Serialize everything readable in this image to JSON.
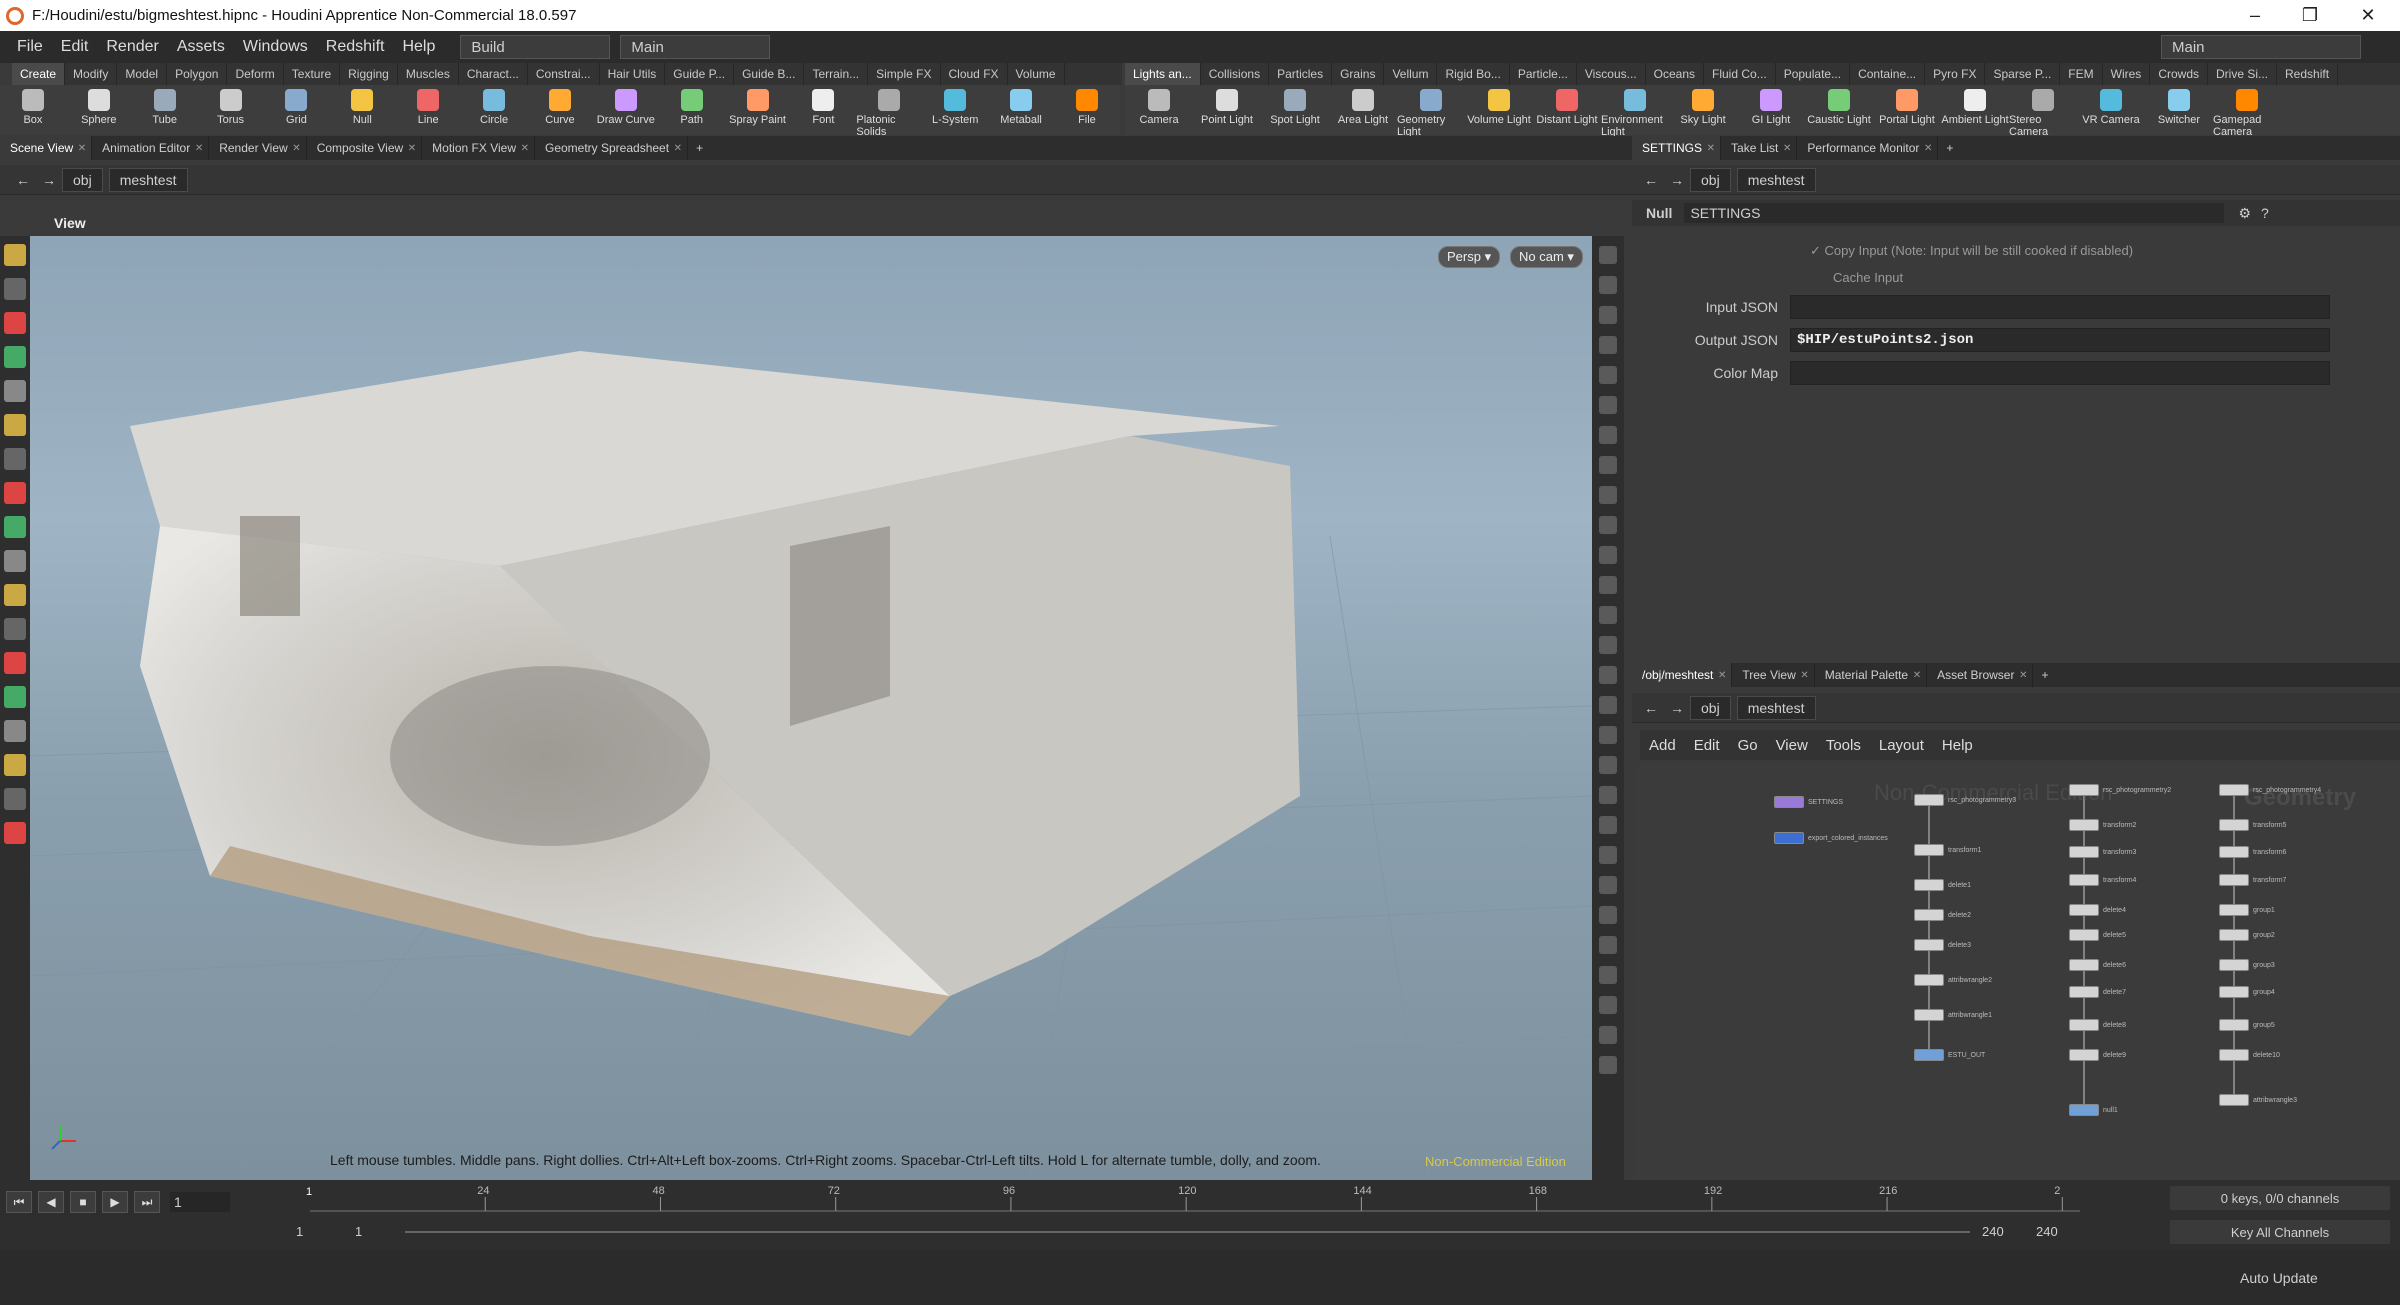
{
  "title_bar": {
    "text": "F:/Houdini/estu/bigmeshtest.hipnc - Houdini Apprentice Non-Commercial 18.0.597"
  },
  "menu": {
    "items": [
      "File",
      "Edit",
      "Render",
      "Assets",
      "Windows",
      "Redshift",
      "Help"
    ],
    "desktop": "Build",
    "desktop2": "Main",
    "right_desktop": "Main"
  },
  "shelf_tabs_left": [
    "Create",
    "Modify",
    "Model",
    "Polygon",
    "Deform",
    "Texture",
    "Rigging",
    "Muscles",
    "Charact...",
    "Constrai...",
    "Hair Utils",
    "Guide P...",
    "Guide B...",
    "Terrain...",
    "Simple FX",
    "Cloud FX",
    "Volume"
  ],
  "shelf_tabs_right": [
    "Lights an...",
    "Collisions",
    "Particles",
    "Grains",
    "Vellum",
    "Rigid Bo...",
    "Particle...",
    "Viscous...",
    "Oceans",
    "Fluid Co...",
    "Populate...",
    "Containe...",
    "Pyro FX",
    "Sparse P...",
    "FEM",
    "Wires",
    "Crowds",
    "Drive Si...",
    "Redshift"
  ],
  "tools_left": [
    "Box",
    "Sphere",
    "Tube",
    "Torus",
    "Grid",
    "Null",
    "Line",
    "Circle",
    "Curve",
    "Draw Curve",
    "Path",
    "Spray Paint",
    "Font",
    "Platonic Solids",
    "L-System",
    "Metaball",
    "File"
  ],
  "tools_right": [
    "Camera",
    "Point Light",
    "Spot Light",
    "Area Light",
    "Geometry Light",
    "Volume Light",
    "Distant Light",
    "Environment Light",
    "Sky Light",
    "GI Light",
    "Caustic Light",
    "Portal Light",
    "Ambient Light",
    "Stereo Camera",
    "VR Camera",
    "Switcher",
    "Gamepad Camera"
  ],
  "left_pane_tabs": [
    "Scene View",
    "Animation Editor",
    "Render View",
    "Composite View",
    "Motion FX View",
    "Geometry Spreadsheet"
  ],
  "right_top_tabs": [
    "SETTINGS",
    "Take List",
    "Performance Monitor"
  ],
  "right_bottom_tabs": [
    "/obj/meshtest",
    "Tree View",
    "Material Palette",
    "Asset Browser"
  ],
  "path": {
    "root": "obj",
    "node": "meshtest"
  },
  "viewport": {
    "title": "View",
    "persp": "Persp ▾",
    "cam": "No cam ▾",
    "hint": "Left mouse tumbles. Middle pans. Right dollies. Ctrl+Alt+Left box-zooms. Ctrl+Right zooms. Spacebar-Ctrl-Left tilts. Hold L for alternate tumble, dolly, and zoom.",
    "watermark": "Non-Commercial Edition"
  },
  "parms": {
    "node_type": "Null",
    "node_name": "SETTINGS",
    "copy_input": "Copy Input (Note: Input will be still cooked if disabled)",
    "cache_input": "Cache Input",
    "input_json_label": "Input JSON",
    "input_json": "",
    "output_json_label": "Output JSON",
    "output_json": "$HIP/estuPoints2.json",
    "color_map_label": "Color Map",
    "color_map": ""
  },
  "network_menu": [
    "Add",
    "Edit",
    "Go",
    "View",
    "Tools",
    "Layout",
    "Help"
  ],
  "network": {
    "wm1": "Non-Commercial Edition",
    "wm2": "Geometry",
    "col_settings": [
      "SETTINGS",
      "export_colored_instances"
    ],
    "col1": [
      "rsc_photogrammetry3",
      "transform1",
      "delete1",
      "delete2",
      "delete3",
      "attribwrangle2",
      "attribwrangle1",
      "ESTU_OUT"
    ],
    "col2": [
      "rsc_photogrammetry2",
      "transform2",
      "transform3",
      "transform4",
      "delete4",
      "delete5",
      "delete6",
      "delete7",
      "delete8",
      "delete9",
      "null1"
    ],
    "col3": [
      "rsc_photogrammetry4",
      "transform5",
      "transform6",
      "transform7",
      "group1",
      "group2",
      "group3",
      "group4",
      "group5",
      "delete10",
      "attribwrangle3"
    ]
  },
  "timeline": {
    "ticks": [
      "24",
      "48",
      "72",
      "96",
      "120",
      "144",
      "168",
      "192",
      "216",
      "2"
    ],
    "current_frame": "1",
    "start": "1",
    "start2": "1",
    "end": "240",
    "end2": "240",
    "marker": "1",
    "keys": "0 keys, 0/0 channels",
    "key_all": "Key All Channels",
    "auto_update": "Auto Update"
  }
}
